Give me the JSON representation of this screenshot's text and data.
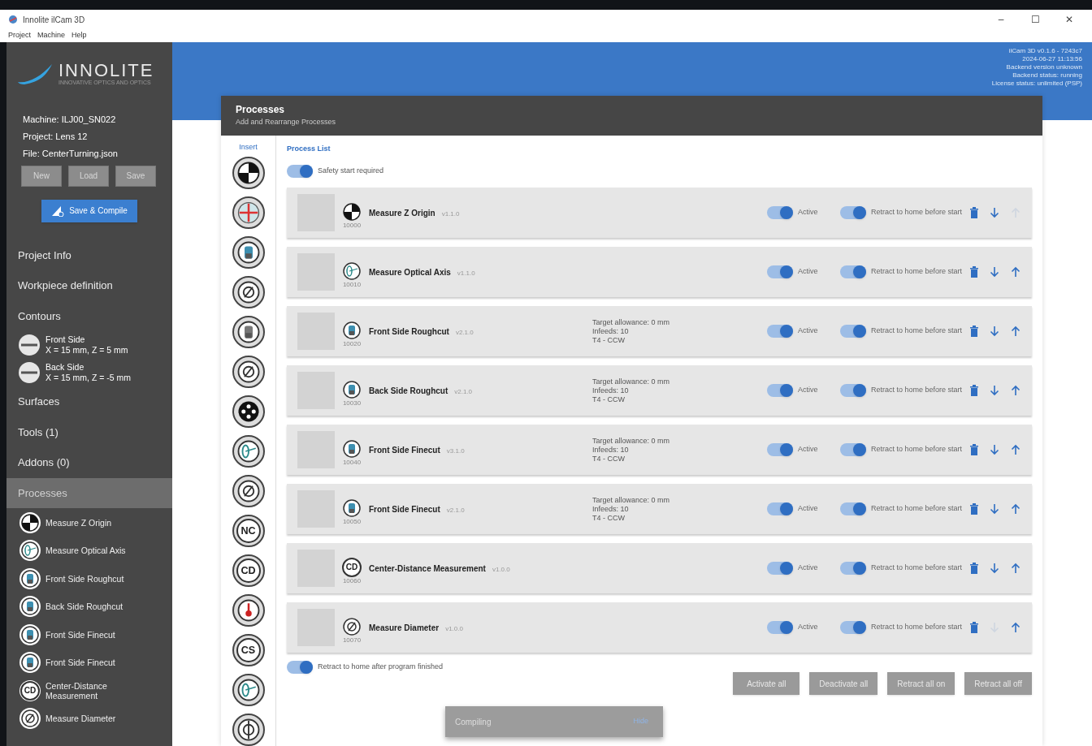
{
  "window": {
    "title": "Innolite ilCam 3D",
    "controls": [
      "–",
      "☐",
      "✕"
    ]
  },
  "menu": [
    "Project",
    "Machine",
    "Help"
  ],
  "sidebar": {
    "logo": "INNOLITE",
    "logo_tagline": "INNOVATIVE OPTICS AND OPTICS",
    "info": [
      "Machine: ILJ00_SN022",
      "Project: Lens 12",
      "File: CenterTurning.json"
    ],
    "file_buttons": [
      "New",
      "Load",
      "Save"
    ],
    "compile_button": "Save & Compile",
    "items": [
      {
        "kind": "section",
        "label": "Project Info",
        "selected": false
      },
      {
        "kind": "section",
        "label": "Workpiece definition",
        "selected": false
      },
      {
        "kind": "section",
        "label": "Contours",
        "selected": false
      },
      {
        "kind": "contour",
        "label": "Front Side",
        "sub": "X = 15 mm, Z = 5 mm"
      },
      {
        "kind": "contour",
        "label": "Back Side",
        "sub": "X = 15 mm, Z = -5 mm"
      },
      {
        "kind": "section",
        "label": "Surfaces",
        "selected": false
      },
      {
        "kind": "section",
        "label": "Tools (1)",
        "selected": false
      },
      {
        "kind": "section",
        "label": "Addons (0)",
        "selected": false
      },
      {
        "kind": "section",
        "label": "Processes",
        "selected": true
      },
      {
        "kind": "process",
        "label": "Measure Z Origin"
      },
      {
        "kind": "process",
        "label": "Measure Optical Axis"
      },
      {
        "kind": "process",
        "label": "Front Side Roughcut"
      },
      {
        "kind": "process",
        "label": "Back Side Roughcut"
      },
      {
        "kind": "process",
        "label": "Front Side Finecut"
      },
      {
        "kind": "process",
        "label": "Front Side Finecut"
      },
      {
        "kind": "process",
        "label": "Center-Distance Measurement",
        "icon_label": "CD"
      },
      {
        "kind": "process",
        "label": "Measure Diameter"
      }
    ]
  },
  "header_info": [
    "ilCam 3D v0.1.6 - 7243c7",
    "2024-06-27 11:13:56",
    "Backend version unknown",
    "Backend status: running",
    "License status: unlimited (PSP)"
  ],
  "panel": {
    "title": "Processes",
    "subtitle": "Add and Rearrange Processes",
    "insert_heading": "Insert",
    "list_heading": "Process List",
    "palette": [
      {
        "kind": "icon"
      },
      {
        "kind": "icon"
      },
      {
        "kind": "icon"
      },
      {
        "kind": "icon"
      },
      {
        "kind": "icon"
      },
      {
        "kind": "icon"
      },
      {
        "kind": "icon"
      },
      {
        "kind": "icon"
      },
      {
        "kind": "icon"
      },
      {
        "kind": "lettered",
        "label": "NC"
      },
      {
        "kind": "lettered",
        "label": "CD"
      },
      {
        "kind": "icon"
      },
      {
        "kind": "lettered",
        "label": "CS"
      },
      {
        "kind": "icon"
      },
      {
        "kind": "icon"
      }
    ],
    "safety_start": {
      "label": "Safety start required",
      "on": true
    },
    "processes": [
      {
        "name": "Measure Z Origin",
        "version": "v1.1.0",
        "id": "10000",
        "active": true,
        "active_label": "Active",
        "retract": true,
        "retract_label": "Retract to home before start",
        "down_enabled": true,
        "up_enabled": false
      },
      {
        "name": "Measure Optical Axis",
        "version": "v1.1.0",
        "id": "10010",
        "active": true,
        "active_label": "Active",
        "retract": true,
        "retract_label": "Retract to home before start",
        "down_enabled": true,
        "up_enabled": true
      },
      {
        "name": "Front Side Roughcut",
        "version": "v2.1.0",
        "id": "10020",
        "details": [
          "Target allowance: 0 mm",
          "Infeeds: 10",
          "T4 - CCW"
        ],
        "active": true,
        "active_label": "Active",
        "retract": true,
        "retract_label": "Retract to home before start",
        "down_enabled": true,
        "up_enabled": true
      },
      {
        "name": "Back Side Roughcut",
        "version": "v2.1.0",
        "id": "10030",
        "details": [
          "Target allowance: 0 mm",
          "Infeeds: 10",
          "T4 - CCW"
        ],
        "active": true,
        "active_label": "Active",
        "retract": true,
        "retract_label": "Retract to home before start",
        "down_enabled": true,
        "up_enabled": true
      },
      {
        "name": "Front Side Finecut",
        "version": "v3.1.0",
        "id": "10040",
        "details": [
          "Target allowance: 0 mm",
          "Infeeds: 10",
          "T4 - CCW"
        ],
        "active": true,
        "active_label": "Active",
        "retract": true,
        "retract_label": "Retract to home before start",
        "down_enabled": true,
        "up_enabled": true
      },
      {
        "name": "Front Side Finecut",
        "version": "v2.1.0",
        "id": "10050",
        "details": [
          "Target allowance: 0 mm",
          "Infeeds: 10",
          "T4 - CCW"
        ],
        "active": true,
        "active_label": "Active",
        "retract": true,
        "retract_label": "Retract to home before start",
        "down_enabled": true,
        "up_enabled": true
      },
      {
        "name": "Center-Distance Measurement",
        "version": "v1.0.0",
        "id": "10060",
        "icon_label": "CD",
        "active": true,
        "active_label": "Active",
        "retract": true,
        "retract_label": "Retract to home before start",
        "down_enabled": true,
        "up_enabled": true
      },
      {
        "name": "Measure Diameter",
        "version": "v1.0.0",
        "id": "10070",
        "active": true,
        "active_label": "Active",
        "retract": true,
        "retract_label": "Retract to home before start",
        "down_enabled": false,
        "up_enabled": true
      }
    ],
    "retract_after": {
      "label": "Retract to home after program finished",
      "on": true
    },
    "bulk_buttons": [
      "Activate all",
      "Deactivate all",
      "Retract all on",
      "Retract all off"
    ]
  },
  "snackbar": {
    "message": "Compiling",
    "action": "Hide"
  }
}
